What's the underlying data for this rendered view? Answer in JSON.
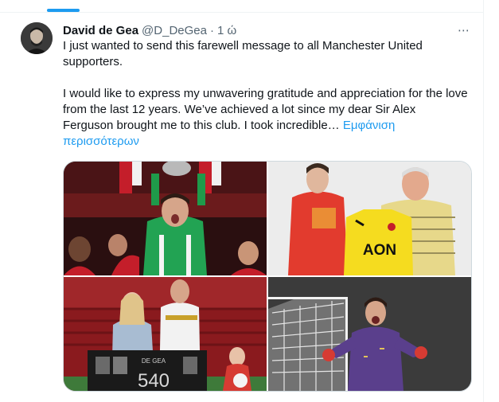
{
  "tweet": {
    "author_name": "David de Gea",
    "author_handle": "@D_DeGea",
    "separator": "·",
    "time": "1 ώ",
    "paragraph_1": "I just wanted to send this farewell message to all Manchester United supporters.",
    "paragraph_2": "I would like to express my unwavering gratitude and appreciation for the love from the last 12 years. We’ve achieved a lot since my dear Sir Alex Ferguson brought me to this club. I took incredible…",
    "show_more": "Εμφάνιση περισσότερων",
    "more_icon": "⋯"
  },
  "media": {
    "shirt_sponsor": "AON",
    "plaque_name": "DE GEA",
    "plaque_number": "540"
  },
  "colors": {
    "accent": "#1d9bf0",
    "text": "#0f1419",
    "secondary": "#536471",
    "border": "#cfd9de"
  }
}
